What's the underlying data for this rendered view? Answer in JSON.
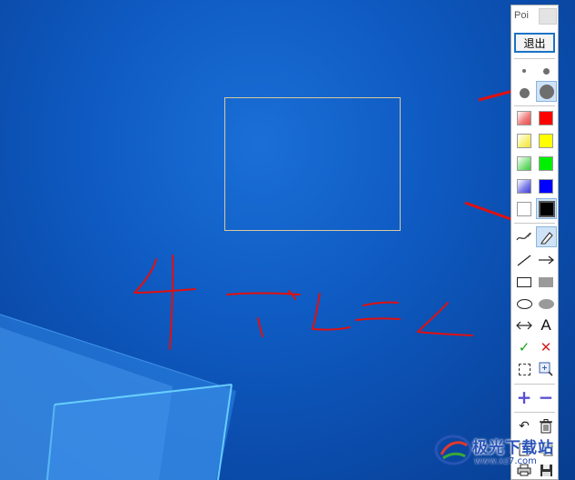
{
  "toolbar": {
    "title": "Poi",
    "exit_label": "退出",
    "brush_sizes": [
      "small",
      "medium",
      "large",
      "x-large"
    ],
    "selected_brush_size": "x-large",
    "colors": [
      {
        "name": "light-red",
        "hex": "#f07a7a"
      },
      {
        "name": "red",
        "hex": "#ff0000"
      },
      {
        "name": "light-yellow",
        "hex": "#f8f070"
      },
      {
        "name": "yellow",
        "hex": "#ffff00"
      },
      {
        "name": "light-green",
        "hex": "#7fe07f"
      },
      {
        "name": "green",
        "hex": "#00ee00"
      },
      {
        "name": "light-blue",
        "hex": "#7a7ae8"
      },
      {
        "name": "blue",
        "hex": "#0000ff"
      },
      {
        "name": "white",
        "hex": "#ffffff"
      },
      {
        "name": "black",
        "hex": "#000000"
      }
    ],
    "selected_color": "black",
    "tools": {
      "pen": "pen-icon",
      "highlighter": "highlighter-icon",
      "line": "line-icon",
      "arrow": "arrow-icon",
      "rect": "rectangle-icon",
      "filled_rect": "filled-rectangle-icon",
      "ellipse": "ellipse-icon",
      "filled_ellipse": "filled-ellipse-icon",
      "double_arrow": "double-arrow-icon",
      "text_label": "A",
      "confirm": "check-icon",
      "cancel": "x-icon",
      "select": "selection-icon",
      "zoom": "zoom-icon",
      "plus": "plus-icon",
      "minus": "minus-icon",
      "undo": "undo-icon",
      "delete": "trash-icon",
      "new_page": "new-page-icon",
      "copy": "copy-icon",
      "print": "print-icon",
      "save": "save-icon"
    },
    "selected_tool": "highlighter"
  },
  "accent": "#1a73c6",
  "annotation_color": "#e01010",
  "watermark": {
    "text": "极光下载站",
    "url": "www.xz7.com"
  }
}
